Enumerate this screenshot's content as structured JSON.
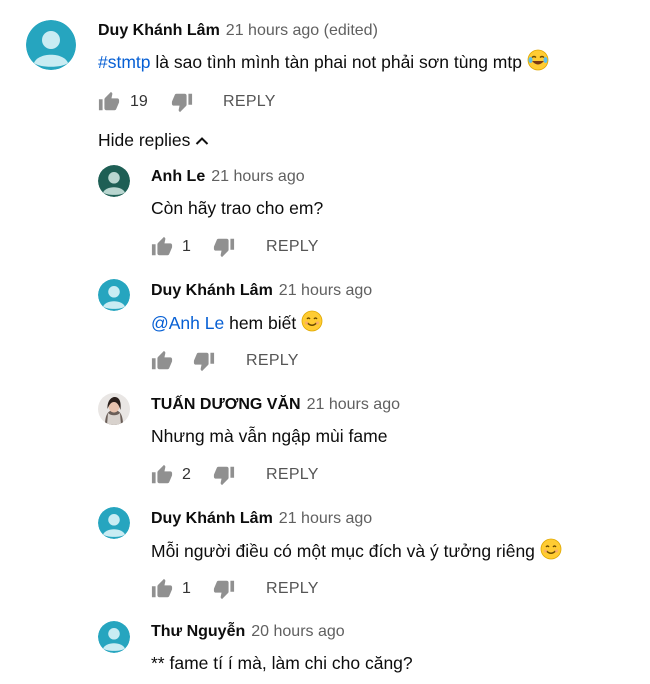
{
  "colors": {
    "avatar_teal": "#26a5bf",
    "avatar_dark_green": "#1e5f55",
    "mention_blue": "#065fd4",
    "text": "#0d0d0d",
    "secondary_text": "#606060"
  },
  "main_comment": {
    "author": "Duy Khánh Lâm",
    "time": "21 hours ago (edited)",
    "mention": "#stmtp",
    "text": " là sao tình mình tàn phai not phải sơn tùng mtp",
    "emoji": "face-with-tears-of-joy",
    "like_count": "19",
    "reply_label": "REPLY",
    "avatar_icon": "default-avatar-icon"
  },
  "hide_replies_label": "Hide replies",
  "replies": [
    {
      "author": "Anh Le",
      "time": "21 hours ago",
      "mention": "",
      "text": "Còn hãy trao cho em?",
      "emoji": "",
      "like_count": "1",
      "reply_label": "REPLY",
      "avatar_icon": "default-avatar-icon"
    },
    {
      "author": "Duy Khánh Lâm",
      "time": "21 hours ago",
      "mention": "@Anh Le",
      "text": " hem biết",
      "emoji": "smiling-face",
      "like_count": "",
      "reply_label": "REPLY",
      "avatar_icon": "default-avatar-icon"
    },
    {
      "author": "TUẤN DƯƠNG VĂN",
      "time": "21 hours ago",
      "mention": "",
      "text": "Nhưng mà vẫn ngập mùi fame",
      "emoji": "",
      "like_count": "2",
      "reply_label": "REPLY",
      "avatar_icon": "photo-avatar-icon"
    },
    {
      "author": "Duy Khánh Lâm",
      "time": "21 hours ago",
      "mention": "",
      "text": "Mỗi người điều có một mục đích và ý tưởng riêng",
      "emoji": "smiling-face",
      "like_count": "1",
      "reply_label": "REPLY",
      "avatar_icon": "default-avatar-icon"
    },
    {
      "author": "Thư Nguyễn",
      "time": "20 hours ago",
      "mention": "",
      "text": "** fame tí í mà, làm chi cho căng?",
      "emoji": "",
      "like_count": "",
      "reply_label": "",
      "avatar_icon": "default-avatar-icon"
    }
  ]
}
